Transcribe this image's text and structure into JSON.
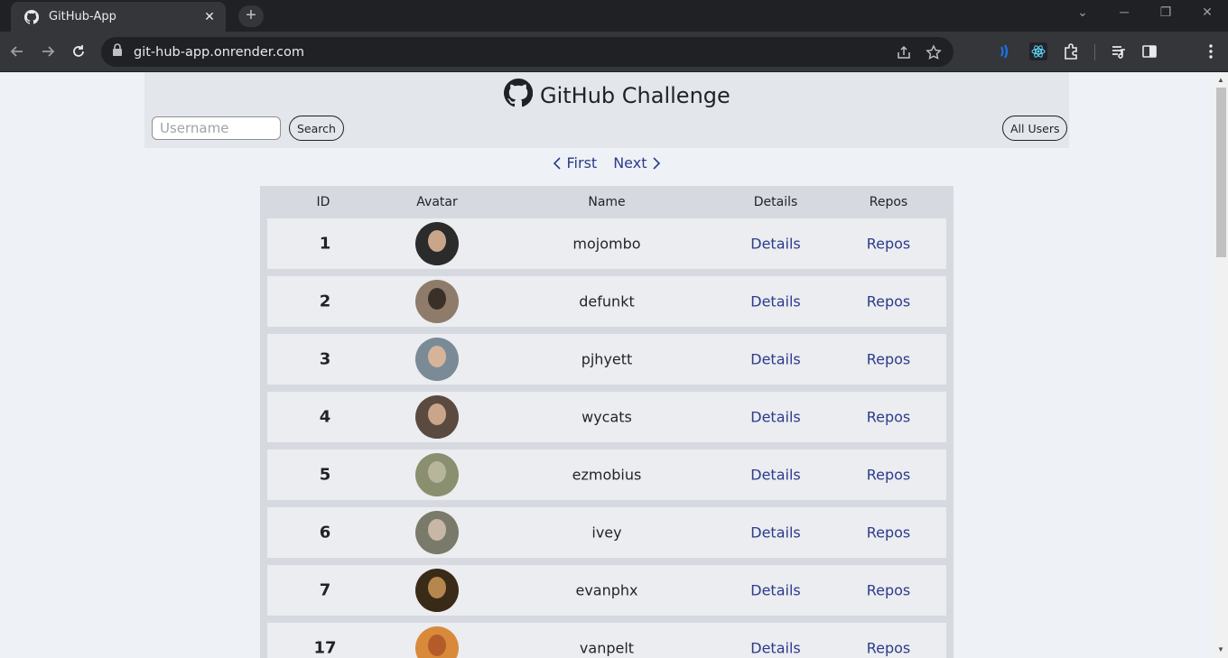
{
  "browser": {
    "tab_title": "GitHub-App",
    "url": "git-hub-app.onrender.com",
    "colors": {
      "frame": "#202124",
      "toolbar": "#35363a"
    }
  },
  "app": {
    "title": "GitHub Challenge",
    "search_placeholder": "Username",
    "search_label": "Search",
    "all_users_label": "All Users",
    "pager": {
      "first": "First",
      "next": "Next"
    },
    "columns": [
      "ID",
      "Avatar",
      "Name",
      "Details",
      "Repos"
    ],
    "rows": [
      {
        "id": "1",
        "name": "mojombo",
        "details": "Details",
        "repos": "Repos",
        "avatar_colors": [
          "#2b2b2b",
          "#c9a58a"
        ]
      },
      {
        "id": "2",
        "name": "defunkt",
        "details": "Details",
        "repos": "Repos",
        "avatar_colors": [
          "#8e7b6a",
          "#3a3028"
        ]
      },
      {
        "id": "3",
        "name": "pjhyett",
        "details": "Details",
        "repos": "Repos",
        "avatar_colors": [
          "#7a8a96",
          "#d6b49a"
        ]
      },
      {
        "id": "4",
        "name": "wycats",
        "details": "Details",
        "repos": "Repos",
        "avatar_colors": [
          "#5a4a40",
          "#c9a58a"
        ]
      },
      {
        "id": "5",
        "name": "ezmobius",
        "details": "Details",
        "repos": "Repos",
        "avatar_colors": [
          "#8a8f70",
          "#b7b59a"
        ]
      },
      {
        "id": "6",
        "name": "ivey",
        "details": "Details",
        "repos": "Repos",
        "avatar_colors": [
          "#7a7a6a",
          "#c8b7a6"
        ]
      },
      {
        "id": "7",
        "name": "evanphx",
        "details": "Details",
        "repos": "Repos",
        "avatar_colors": [
          "#3a2a18",
          "#b5874e"
        ]
      },
      {
        "id": "17",
        "name": "vanpelt",
        "details": "Details",
        "repos": "Repos",
        "avatar_colors": [
          "#d88a3a",
          "#b55b2a"
        ]
      }
    ],
    "colors": {
      "link": "#2d3a8c",
      "header_bg": "#e3e6ea",
      "page_bg": "#eef2f6"
    }
  }
}
